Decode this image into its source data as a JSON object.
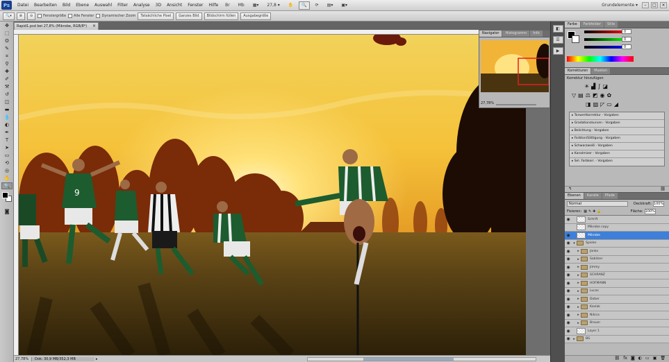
{
  "app": {
    "logo": "Ps",
    "workspace_label": "Grundelemente ▾"
  },
  "menu": [
    "Datei",
    "Bearbeiten",
    "Bild",
    "Ebene",
    "Auswahl",
    "Filter",
    "Analyse",
    "3D",
    "Ansicht",
    "Fenster",
    "Hilfe"
  ],
  "menu_tools": {
    "zoom_label": "27,8 ▾",
    "bridge": "Br",
    "minibridge": "Mb"
  },
  "options_bar": {
    "resize_windows": "Fenstergröße",
    "all_windows": "Alle Fenster",
    "scrubby_zoom": "Dynamischer Zoom",
    "actual_pixels": "Tatsächliche Pixel",
    "fit_screen": "Ganzes Bild",
    "fill_screen": "Bildschirm füllen",
    "print_size": "Ausgabegröße"
  },
  "document": {
    "tab_title": "Rapid1.psd bei 27,8% (Mikrobe, RGB/8*)",
    "zoom": "27,78%",
    "status": "Dok: 30,9 MB/352,3 MB"
  },
  "navigator": {
    "tabs": [
      "Navigator",
      "Histogramm",
      "Info"
    ],
    "zoom": "27,78%"
  },
  "color_panel": {
    "tabs": [
      "Farbe",
      "Farbfelder",
      "Stile"
    ],
    "r": "0",
    "g": "0",
    "b": "0"
  },
  "adjustments": {
    "tabs": [
      "Korrekturen",
      "Masken"
    ],
    "title": "Korrektur hinzufügen",
    "presets": [
      "Tonwertkorrektur - Vorgaben",
      "Gradationskurven - Vorgaben",
      "Belichtung - Vorgaben",
      "Farbton/Sättigung - Vorgaben",
      "Schwarzweiß - Vorgaben",
      "Kanalmixer - Vorgaben",
      "Sel. Farbkorr. - Vorgaben"
    ]
  },
  "layers": {
    "tabs": [
      "Ebenen",
      "Kanäle",
      "Pfade"
    ],
    "blend_mode": "Normal",
    "opacity_label": "Deckkraft:",
    "opacity": "100%",
    "fill_label": "Fläche:",
    "fill": "100%",
    "lock_label": "Fixieren:",
    "items": [
      {
        "name": "Schrift",
        "type": "layer",
        "selected": false
      },
      {
        "name": "Mikrobe copy",
        "type": "layer",
        "selected": false
      },
      {
        "name": "Mikrobe",
        "type": "layer",
        "selected": true
      },
      {
        "name": "Spieler",
        "type": "folder",
        "selected": false
      },
      {
        "name": "Janko",
        "type": "folder",
        "selected": false
      },
      {
        "name": "Sabitzer",
        "type": "folder",
        "selected": false
      },
      {
        "name": "Jimmy",
        "type": "folder",
        "selected": false
      },
      {
        "name": "SCHRANZ",
        "type": "folder",
        "selected": false
      },
      {
        "name": "HOFMANN",
        "type": "folder",
        "selected": false
      },
      {
        "name": "Lucas",
        "type": "folder",
        "selected": false
      },
      {
        "name": "Dober",
        "type": "folder",
        "selected": false
      },
      {
        "name": "Kavlak",
        "type": "folder",
        "selected": false
      },
      {
        "name": "Nikica",
        "type": "folder",
        "selected": false
      },
      {
        "name": "Brauer",
        "type": "folder",
        "selected": false
      },
      {
        "name": "Layer 1",
        "type": "layer",
        "selected": false
      },
      {
        "name": "BG",
        "type": "folder",
        "selected": false
      }
    ]
  },
  "colors": {
    "accent": "#3d7fd9",
    "sky_top": "#f2d25a",
    "sun": "#ffe27a",
    "field": "#463410"
  }
}
